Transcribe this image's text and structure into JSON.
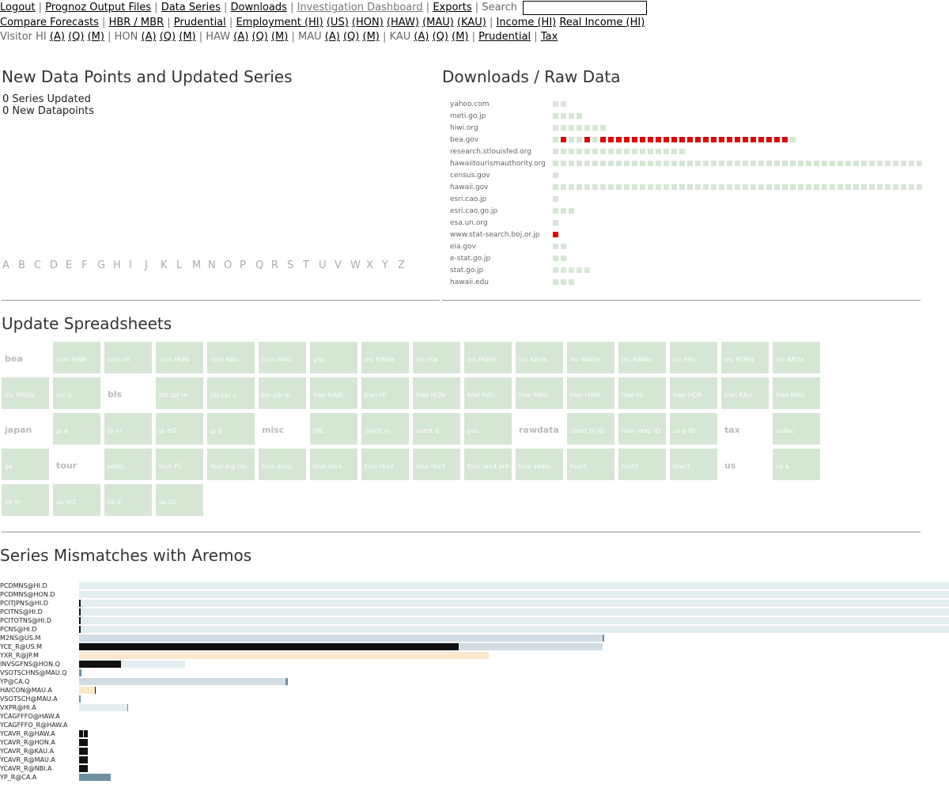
{
  "nav": {
    "row1": {
      "logout": "Logout",
      "prognoz": "Prognoz Output Files",
      "data_series": "Data Series",
      "downloads": "Downloads",
      "investigation": "Investigation Dashboard",
      "exports": "Exports",
      "search_label": "Search",
      "search_value": ""
    },
    "row2": {
      "compare": "Compare Forecasts",
      "hbr": "HBR / MBR",
      "prudential": "Prudential",
      "employment": "Employment (HI)",
      "emp_us": "(US)",
      "emp_hon": "(HON)",
      "emp_haw": "(HAW)",
      "emp_mau": "(MAU)",
      "emp_kau": "(KAU)",
      "income": "Income (HI)",
      "real_income": "Real Income (HI)"
    },
    "row3": {
      "visitor": "Visitor HI",
      "hon": "HON",
      "haw": "HAW",
      "mau": "MAU",
      "kau": "KAU",
      "a": "(A)",
      "q": "(Q)",
      "m": "(M)",
      "prudential": "Prudential",
      "tax": "Tax"
    }
  },
  "updates": {
    "title": "New Data Points and Updated Series",
    "series_updated": "0 Series Updated",
    "new_datapoints": "0 New Datapoints",
    "alphabet": [
      "A",
      "B",
      "C",
      "D",
      "E",
      "F",
      "G",
      "H",
      "I",
      "J",
      "K",
      "L",
      "M",
      "N",
      "O",
      "P",
      "Q",
      "R",
      "S",
      "T",
      "U",
      "V",
      "W",
      "X",
      "Y",
      "Z"
    ]
  },
  "downloads": {
    "title": "Downloads / Raw Data",
    "sources": [
      {
        "name": "yahoo.com",
        "status": "gg"
      },
      {
        "name": "meti.go.jp",
        "status": "gggg"
      },
      {
        "name": "hiwi.org",
        "status": "ggggggg"
      },
      {
        "name": "bea.gov",
        "status": "grggrgrrrrrrrrrrrrrrrrrrrrrrrrg"
      },
      {
        "name": "research.stlouisfed.org",
        "status": "ggggggggggggggggg"
      },
      {
        "name": "hawaiitourismauthority.org",
        "status": "ggggggggggggggggggggggggggggggggggggggggggggggg"
      },
      {
        "name": "census.gov",
        "status": "g"
      },
      {
        "name": "hawaii.gov",
        "status": "ggggggggggggggggggggggggggggggggggggggggggggggg"
      },
      {
        "name": "esri.cao.jp",
        "status": "g"
      },
      {
        "name": "esri.cao.go.jp",
        "status": "ggg"
      },
      {
        "name": "esa.un.org",
        "status": "g"
      },
      {
        "name": "www.stat-search.boj.or.jp",
        "status": "r"
      },
      {
        "name": "eia.gov",
        "status": "gg"
      },
      {
        "name": "e-stat.go.jp",
        "status": "gg"
      },
      {
        "name": "stat.go.jp",
        "status": "ggggg"
      },
      {
        "name": "hawaii.edu",
        "status": "ggg"
      }
    ]
  },
  "spreadsheets": {
    "title": "Update Spreadsheets",
    "cells": [
      {
        "label": "bea",
        "type": "group"
      },
      {
        "label": "com HAW",
        "type": "tile"
      },
      {
        "label": "com HI",
        "type": "tile"
      },
      {
        "label": "com HON",
        "type": "tile"
      },
      {
        "label": "com KAU",
        "type": "tile"
      },
      {
        "label": "com MAU",
        "type": "tile"
      },
      {
        "label": "gsp",
        "type": "tile"
      },
      {
        "label": "inc HAWa",
        "type": "tile"
      },
      {
        "label": "inc HIa",
        "type": "tile"
      },
      {
        "label": "inc HONa",
        "type": "tile"
      },
      {
        "label": "inc KAUa",
        "type": "tile"
      },
      {
        "label": "inc MAUa",
        "type": "tile"
      },
      {
        "label": "inc HAWa",
        "type": "tile"
      },
      {
        "label": "inc HIa",
        "type": "tile"
      },
      {
        "label": "inc HONa",
        "type": "tile"
      },
      {
        "label": "inc KAUa",
        "type": "tile"
      },
      {
        "label": "inc MAUa",
        "type": "tile"
      },
      {
        "label": "inc q",
        "type": "tile"
      },
      {
        "label": "bls",
        "type": "group"
      },
      {
        "label": "bls cpi m",
        "type": "tile"
      },
      {
        "label": "bls cpi s",
        "type": "tile"
      },
      {
        "label": "bls job m",
        "type": "tile"
      },
      {
        "label": "hiwi HAW",
        "type": "tile"
      },
      {
        "label": "hiwi HI",
        "type": "tile"
      },
      {
        "label": "hiwi HON",
        "type": "tile"
      },
      {
        "label": "hiwi KAU",
        "type": "tile"
      },
      {
        "label": "hiwi MAU",
        "type": "tile"
      },
      {
        "label": "hiwi HAW",
        "type": "tile"
      },
      {
        "label": "hiwi HI",
        "type": "tile"
      },
      {
        "label": "hiwi HON",
        "type": "tile"
      },
      {
        "label": "hiwi KAU",
        "type": "tile"
      },
      {
        "label": "hiwi MAU",
        "type": "tile"
      },
      {
        "label": "japan",
        "type": "group"
      },
      {
        "label": "jp a",
        "type": "tile"
      },
      {
        "label": "jp m",
        "type": "tile"
      },
      {
        "label": "jp m2",
        "type": "tile"
      },
      {
        "label": "jp q",
        "type": "tile"
      },
      {
        "label": "misc",
        "type": "group"
      },
      {
        "label": "UIC",
        "type": "tile"
      },
      {
        "label": "const m",
        "type": "tile"
      },
      {
        "label": "const q",
        "type": "tile"
      },
      {
        "label": "pos",
        "type": "tile"
      },
      {
        "label": "rawdata",
        "type": "group"
      },
      {
        "label": "const m ID",
        "type": "tile"
      },
      {
        "label": "tour vexp ID",
        "type": "tile"
      },
      {
        "label": "us q ID",
        "type": "tile"
      },
      {
        "label": "tax",
        "type": "group"
      },
      {
        "label": "collec",
        "type": "tile"
      },
      {
        "label": "ge",
        "type": "tile"
      },
      {
        "label": "tour",
        "type": "group"
      },
      {
        "label": "seats",
        "type": "tile"
      },
      {
        "label": "tour PC",
        "type": "tile"
      },
      {
        "label": "tour big isv",
        "type": "tile"
      },
      {
        "label": "tour ocup",
        "type": "tile"
      },
      {
        "label": "tour rev1",
        "type": "tile"
      },
      {
        "label": "tour rev2",
        "type": "tile"
      },
      {
        "label": "tour rev3",
        "type": "tile"
      },
      {
        "label": "tour rev3 pre",
        "type": "tile"
      },
      {
        "label": "tour seats",
        "type": "tile"
      },
      {
        "label": "tour1",
        "type": "tile"
      },
      {
        "label": "tour2",
        "type": "tile"
      },
      {
        "label": "tour3",
        "type": "tile"
      },
      {
        "label": "us",
        "type": "group"
      },
      {
        "label": "us a",
        "type": "tile"
      },
      {
        "label": "us m",
        "type": "tile"
      },
      {
        "label": "us m2",
        "type": "tile"
      },
      {
        "label": "us q",
        "type": "tile"
      },
      {
        "label": "us q2",
        "type": "tile"
      }
    ]
  },
  "mismatches": {
    "title": "Series Mismatches with Aremos",
    "colors": {
      "light": "#e3eef1",
      "gray": "#d1dce3",
      "dark": "#111111",
      "peach": "#fde8cc",
      "steel": "#6b8fa3"
    },
    "rows": [
      {
        "name": "PCDMNS@HI.D",
        "segments": [
          {
            "color": "light",
            "from": 0.0,
            "to": 1.0
          }
        ]
      },
      {
        "name": "PCDMNS@HON.D",
        "segments": [
          {
            "color": "light",
            "from": 0.0,
            "to": 1.0
          }
        ]
      },
      {
        "name": "PCITJPNS@HI.D",
        "segments": [
          {
            "color": "dark",
            "from": 0.0,
            "to": 0.0018
          },
          {
            "color": "light",
            "from": 0.0018,
            "to": 1.0
          }
        ]
      },
      {
        "name": "PCITNS@HI.D",
        "segments": [
          {
            "color": "dark",
            "from": 0.0,
            "to": 0.0018
          },
          {
            "color": "light",
            "from": 0.0018,
            "to": 1.0
          }
        ]
      },
      {
        "name": "PCITOTNS@HI.D",
        "segments": [
          {
            "color": "dark",
            "from": 0.0,
            "to": 0.0018
          },
          {
            "color": "light",
            "from": 0.0018,
            "to": 1.0
          }
        ]
      },
      {
        "name": "PCNS@HI.D",
        "segments": [
          {
            "color": "dark",
            "from": 0.0,
            "to": 0.0018
          },
          {
            "color": "light",
            "from": 0.0018,
            "to": 1.0
          }
        ]
      },
      {
        "name": "M2NS@US.M",
        "segments": [
          {
            "color": "gray",
            "from": 0.0,
            "to": 0.602
          },
          {
            "color": "steel",
            "from": 0.602,
            "to": 0.604
          }
        ]
      },
      {
        "name": "YCE_R@US.M",
        "segments": [
          {
            "color": "dark",
            "from": 0.0,
            "to": 0.436
          },
          {
            "color": "gray",
            "from": 0.436,
            "to": 0.602
          }
        ]
      },
      {
        "name": "YXR_R@JP.M",
        "segments": [
          {
            "color": "peach",
            "from": 0.0,
            "to": 0.471
          }
        ]
      },
      {
        "name": "INVSGFNS@HON.Q",
        "segments": [
          {
            "color": "dark",
            "from": 0.0,
            "to": 0.048
          },
          {
            "color": "light",
            "from": 0.048,
            "to": 0.122
          }
        ]
      },
      {
        "name": "VSOTSCHNS@MAU.Q",
        "segments": [
          {
            "color": "steel",
            "from": 0.0,
            "to": 0.0027
          }
        ]
      },
      {
        "name": "YP@CA.Q",
        "segments": [
          {
            "color": "gray",
            "from": 0.0,
            "to": 0.237
          },
          {
            "color": "steel",
            "from": 0.237,
            "to": 0.24
          }
        ]
      },
      {
        "name": "HAICON@MAU.A",
        "segments": [
          {
            "color": "peach",
            "from": 0.0,
            "to": 0.018
          },
          {
            "color": "dark",
            "from": 0.018,
            "to": 0.0195
          }
        ]
      },
      {
        "name": "VSOTSCH@MAU.A",
        "segments": [
          {
            "color": "steel",
            "from": 0.0,
            "to": 0.0018
          }
        ]
      },
      {
        "name": "VXPR@HI.A",
        "segments": [
          {
            "color": "light",
            "from": 0.0,
            "to": 0.055
          },
          {
            "color": "steel",
            "from": 0.055,
            "to": 0.056
          }
        ]
      },
      {
        "name": "YCAGFFFO@HAW.A",
        "segments": []
      },
      {
        "name": "YCAGFFFO_R@HAW.A",
        "segments": []
      },
      {
        "name": "YCAVR_R@HAW.A",
        "segments": [
          {
            "color": "dark",
            "from": 0.0,
            "to": 0.0045
          },
          {
            "color": "light",
            "from": 0.0045,
            "to": 0.0055
          },
          {
            "color": "dark",
            "from": 0.0055,
            "to": 0.01
          }
        ]
      },
      {
        "name": "YCAVR_R@HON.A",
        "segments": [
          {
            "color": "dark",
            "from": 0.0,
            "to": 0.01
          }
        ]
      },
      {
        "name": "YCAVR_R@KAU.A",
        "segments": [
          {
            "color": "dark",
            "from": 0.0,
            "to": 0.01
          }
        ]
      },
      {
        "name": "YCAVR_R@MAU.A",
        "segments": [
          {
            "color": "dark",
            "from": 0.0,
            "to": 0.01
          }
        ]
      },
      {
        "name": "YCAVR_R@NBI.A",
        "segments": [
          {
            "color": "dark",
            "from": 0.0,
            "to": 0.01
          }
        ]
      },
      {
        "name": "YP_R@CA.A",
        "segments": [
          {
            "color": "steel",
            "from": 0.0,
            "to": 0.036
          }
        ]
      }
    ]
  }
}
